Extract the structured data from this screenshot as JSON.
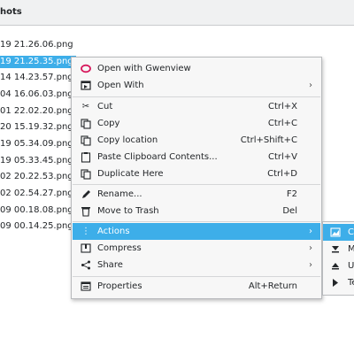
{
  "header": {
    "title": "hots"
  },
  "files": [
    "19 21.26.06.png",
    "19 21.25.35.png",
    "14 14.23.57.png",
    "04 16.06.03.png",
    "01 22.02.20.png",
    "20 15.19.32.png",
    "19 05.34.09.png",
    "19 05.33.45.png",
    "02 20.22.53.png",
    "02 02.54.27.png",
    "09 00.18.08.png",
    "09 00.14.25.png"
  ],
  "selected_file_index": 1,
  "context_menu": {
    "items": [
      {
        "label": "Open with Gwenview",
        "icon": "gwenview-icon",
        "shortcut": "",
        "submenu": false
      },
      {
        "label": "Open With",
        "icon": "open-with-icon",
        "shortcut": "",
        "submenu": true
      },
      {
        "label": "Cut",
        "icon": "cut-icon",
        "shortcut": "Ctrl+X",
        "submenu": false
      },
      {
        "label": "Copy",
        "icon": "copy-icon",
        "shortcut": "Ctrl+C",
        "submenu": false
      },
      {
        "label": "Copy location",
        "icon": "copy-location-icon",
        "shortcut": "Ctrl+Shift+C",
        "submenu": false
      },
      {
        "label": "Paste Clipboard Contents...",
        "icon": "paste-icon",
        "shortcut": "Ctrl+V",
        "submenu": false
      },
      {
        "label": "Duplicate Here",
        "icon": "duplicate-icon",
        "shortcut": "Ctrl+D",
        "submenu": false
      },
      {
        "label": "Rename...",
        "icon": "rename-icon",
        "shortcut": "F2",
        "submenu": false
      },
      {
        "label": "Move to Trash",
        "icon": "trash-icon",
        "shortcut": "Del",
        "submenu": false
      },
      {
        "label": "Actions",
        "icon": "actions-icon",
        "shortcut": "",
        "submenu": true
      },
      {
        "label": "Compress",
        "icon": "compress-icon",
        "shortcut": "",
        "submenu": true
      },
      {
        "label": "Share",
        "icon": "share-icon",
        "shortcut": "",
        "submenu": true
      },
      {
        "label": "Properties",
        "icon": "properties-icon",
        "shortcut": "Alt+Return",
        "submenu": false
      }
    ],
    "highlighted": "Actions"
  },
  "actions_submenu": {
    "items": [
      {
        "label": "C",
        "icon": "image-action-icon"
      },
      {
        "label": "M",
        "icon": "download-icon"
      },
      {
        "label": "U",
        "icon": "eject-icon"
      },
      {
        "label": "Te",
        "icon": "terminal-icon"
      }
    ]
  },
  "colors": {
    "accent": "#3daee9",
    "menu_bg": "#f7f7f7",
    "text": "#232629"
  }
}
